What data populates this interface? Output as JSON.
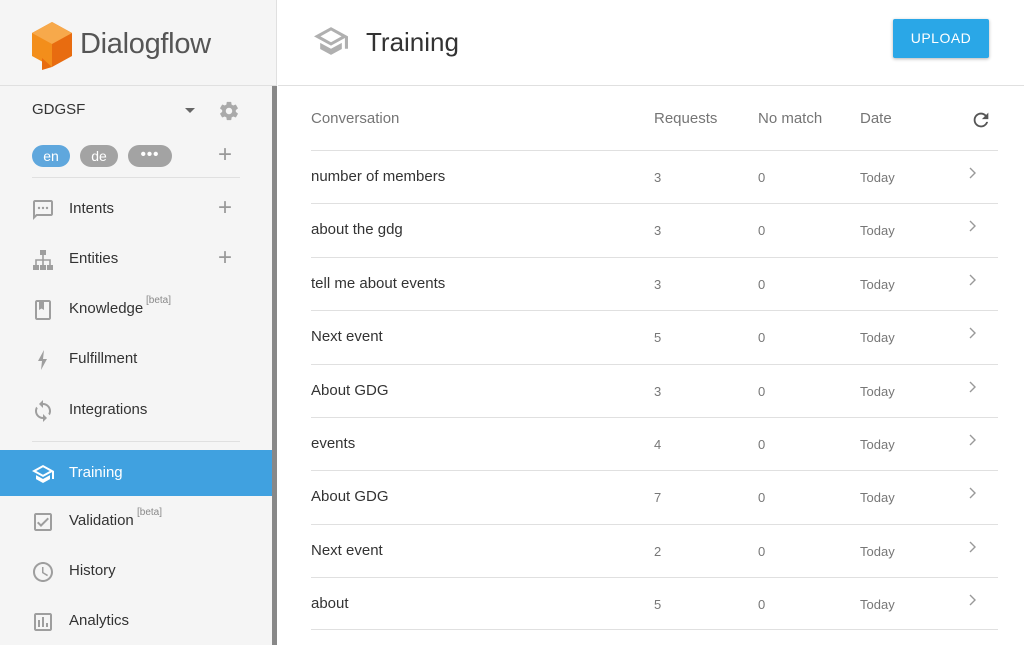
{
  "app": {
    "name": "Dialogflow"
  },
  "agent": {
    "name": "GDGSF"
  },
  "languages": {
    "en": "en",
    "de": "de",
    "more": "•••"
  },
  "nav": {
    "intents": "Intents",
    "entities": "Entities",
    "knowledge": "Knowledge",
    "knowledge_badge": "[beta]",
    "fulfillment": "Fulfillment",
    "integrations": "Integrations",
    "training": "Training",
    "validation": "Validation",
    "validation_badge": "[beta]",
    "history": "History",
    "analytics": "Analytics"
  },
  "page": {
    "title": "Training",
    "upload_label": "UPLOAD"
  },
  "table": {
    "headers": {
      "conversation": "Conversation",
      "requests": "Requests",
      "no_match": "No match",
      "date": "Date"
    },
    "rows": [
      {
        "conversation": "number of members",
        "requests": "3",
        "no_match": "0",
        "date": "Today"
      },
      {
        "conversation": "about the gdg",
        "requests": "3",
        "no_match": "0",
        "date": "Today"
      },
      {
        "conversation": "tell me about events",
        "requests": "3",
        "no_match": "0",
        "date": "Today"
      },
      {
        "conversation": "Next event",
        "requests": "5",
        "no_match": "0",
        "date": "Today"
      },
      {
        "conversation": "About GDG",
        "requests": "3",
        "no_match": "0",
        "date": "Today"
      },
      {
        "conversation": "events",
        "requests": "4",
        "no_match": "0",
        "date": "Today"
      },
      {
        "conversation": "About GDG",
        "requests": "7",
        "no_match": "0",
        "date": "Today"
      },
      {
        "conversation": "Next event",
        "requests": "2",
        "no_match": "0",
        "date": "Today"
      },
      {
        "conversation": "about",
        "requests": "5",
        "no_match": "0",
        "date": "Today"
      }
    ]
  },
  "colors": {
    "brand_orange": "#f38e1b",
    "active_nav": "#40a1e0",
    "upload_button": "#2aa7e7",
    "chip_active": "#5fa7dd",
    "chip_inactive": "#a3a3a3"
  },
  "icons": {
    "logo": "dialogflow-logo-icon",
    "settings": "gear-icon",
    "intents": "chat-bubble-icon",
    "entities": "hierarchy-icon",
    "knowledge": "book-icon",
    "fulfillment": "lightning-icon",
    "integrations": "sync-icon",
    "training": "graduation-cap-icon",
    "validation": "checkbox-icon",
    "history": "clock-icon",
    "analytics": "bar-chart-icon",
    "refresh": "refresh-icon",
    "row_action": "chevron-right-icon"
  }
}
